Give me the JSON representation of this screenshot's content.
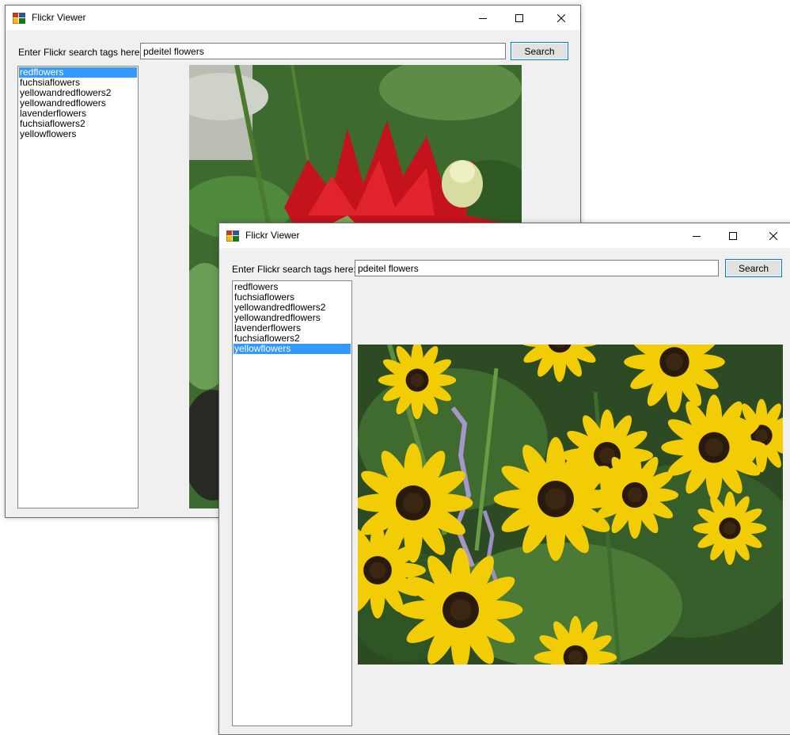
{
  "windows": [
    {
      "title": "Flickr Viewer",
      "search_label": "Enter Flickr search tags here:",
      "search_value": "pdeitel flowers",
      "search_button": "Search",
      "tags": [
        "redflowers",
        "fuchsiaflowers",
        "yellowandredflowers2",
        "yellowandredflowers",
        "lavenderflowers",
        "fuchsiaflowers2",
        "yellowflowers"
      ],
      "selected_tag": "redflowers",
      "photo": "red dahlia flowers"
    },
    {
      "title": "Flickr Viewer",
      "search_label": "Enter Flickr search tags here:",
      "search_value": "pdeitel flowers",
      "search_button": "Search",
      "tags": [
        "redflowers",
        "fuchsiaflowers",
        "yellowandredflowers2",
        "yellowandredflowers",
        "lavenderflowers",
        "fuchsiaflowers2",
        "yellowflowers"
      ],
      "selected_tag": "yellowflowers",
      "photo": "yellow black-eyed susan flowers"
    }
  ],
  "colors": {
    "selection": "#3399ff",
    "window_bg": "#f0f0f0",
    "button_border": "#0078d7"
  },
  "icons": {
    "minimize": "minimize-icon",
    "maximize": "maximize-icon",
    "close": "close-icon",
    "app": "flickr-viewer-app-icon"
  }
}
